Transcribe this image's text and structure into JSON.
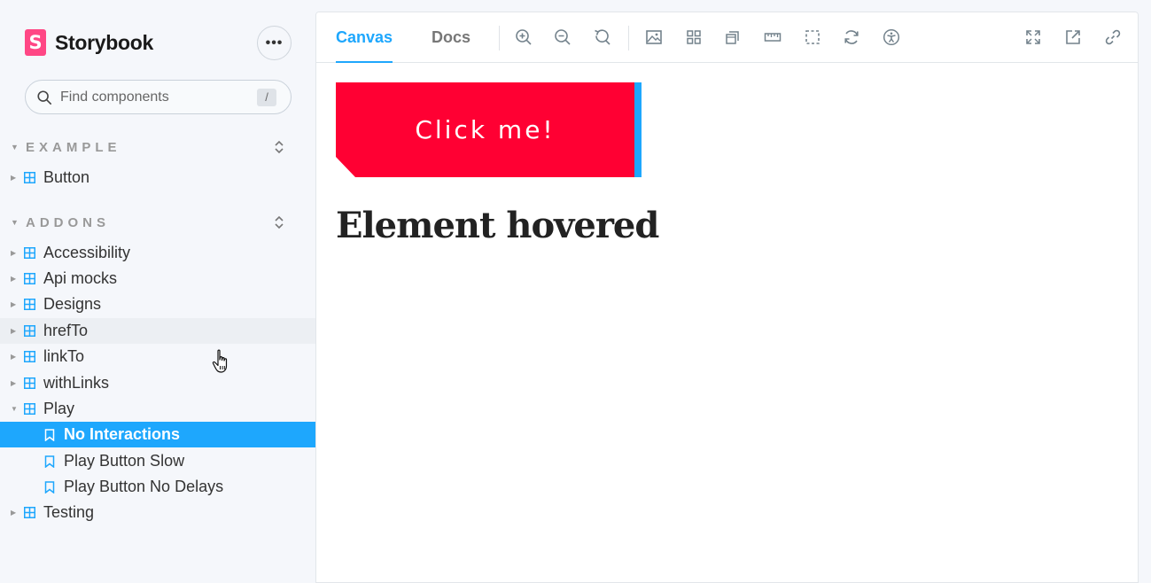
{
  "brand": {
    "logo_letter": "S",
    "name": "Storybook"
  },
  "menu": {
    "label": "•••"
  },
  "search": {
    "placeholder": "Find components",
    "shortcut": "/"
  },
  "sections": [
    {
      "title": "EXAMPLE"
    },
    {
      "title": "ADDONS"
    }
  ],
  "tree": {
    "example": [
      {
        "label": "Button"
      }
    ],
    "addons": [
      {
        "label": "Accessibility"
      },
      {
        "label": "Api mocks"
      },
      {
        "label": "Designs"
      },
      {
        "label": "hrefTo"
      },
      {
        "label": "linkTo"
      },
      {
        "label": "withLinks"
      },
      {
        "label": "Play"
      },
      {
        "label": "No Interactions"
      },
      {
        "label": "Play Button Slow"
      },
      {
        "label": "Play Button No Delays"
      },
      {
        "label": "Testing"
      }
    ]
  },
  "toolbar": {
    "tabs": [
      {
        "label": "Canvas"
      },
      {
        "label": "Docs"
      }
    ],
    "icons": [
      "zoom-in-icon",
      "zoom-out-icon",
      "zoom-reset-icon",
      "background-icon",
      "grid-icon",
      "viewport-icon",
      "measure-icon",
      "outline-icon",
      "remount-icon",
      "accessibility-icon",
      "fullscreen-icon",
      "open-new-tab-icon",
      "copy-link-icon"
    ]
  },
  "canvas": {
    "button_label": "Click me!",
    "heading": "Element hovered"
  },
  "colors": {
    "accent": "#1ea7fd",
    "brand": "#ff4785",
    "demo_button": "#ff0033"
  }
}
